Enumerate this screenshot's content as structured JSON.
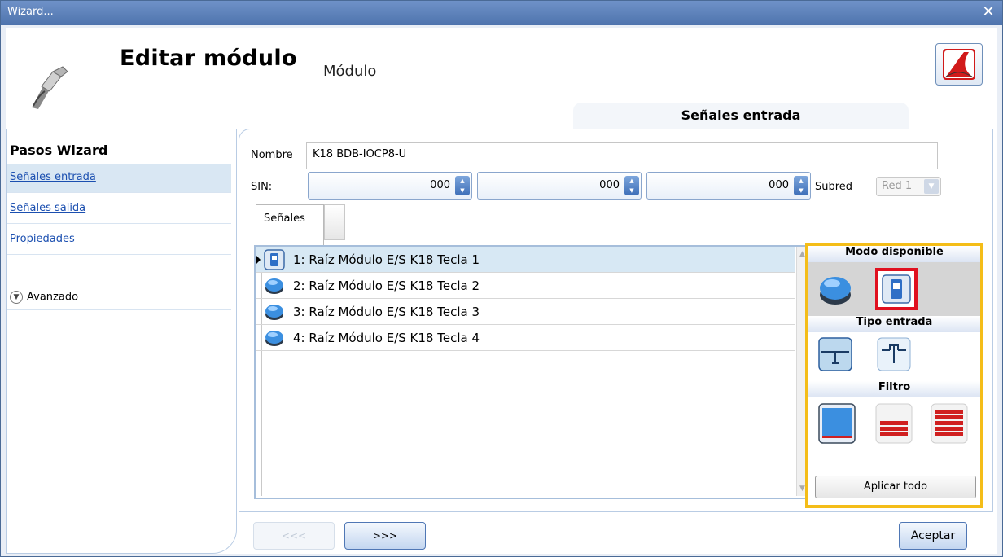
{
  "window": {
    "title": "Wizard...",
    "close_glyph": "✕"
  },
  "header": {
    "title": "Editar módulo",
    "subtitle": "Módulo",
    "logo_icon": "cable-connector-icon",
    "help_icon": "help-book-icon"
  },
  "step_tab": {
    "label": "Señales entrada"
  },
  "sidebar": {
    "title": "Pasos Wizard",
    "items": [
      {
        "label": "Señales entrada",
        "active": true
      },
      {
        "label": "Señales salida",
        "active": false
      },
      {
        "label": "Propiedades",
        "active": false
      }
    ],
    "advanced_label": "Avanzado"
  },
  "form": {
    "name_label": "Nombre",
    "name_value": "K18 BDB-IOCP8-U",
    "sin_label": "SIN:",
    "sin_values": [
      "000",
      "000",
      "000"
    ],
    "subnet_label": "Subred",
    "subnet_value": "Red 1"
  },
  "tabs": {
    "signals_label": "Señales"
  },
  "signals": [
    {
      "label": "1: Raíz Módulo E/S K18 Tecla 1",
      "icon": "switch-key-icon",
      "selected": true
    },
    {
      "label": "2: Raíz Módulo E/S K18 Tecla 2",
      "icon": "pushbutton-icon",
      "selected": false
    },
    {
      "label": "3: Raíz Módulo E/S K18 Tecla 3",
      "icon": "pushbutton-icon",
      "selected": false
    },
    {
      "label": "4: Raíz Módulo E/S K18 Tecla 4",
      "icon": "pushbutton-icon",
      "selected": false
    }
  ],
  "panel": {
    "mode_title": "Modo disponible",
    "input_type_title": "Tipo entrada",
    "filter_title": "Filtro",
    "apply_label": "Aplicar todo"
  },
  "footer": {
    "prev_label": "<<<",
    "next_label": ">>>",
    "accept_label": "Aceptar"
  },
  "colors": {
    "highlight_border": "#f4bd18",
    "selected_mode_border": "#e0101f",
    "titlebar": "#5a7fba"
  }
}
